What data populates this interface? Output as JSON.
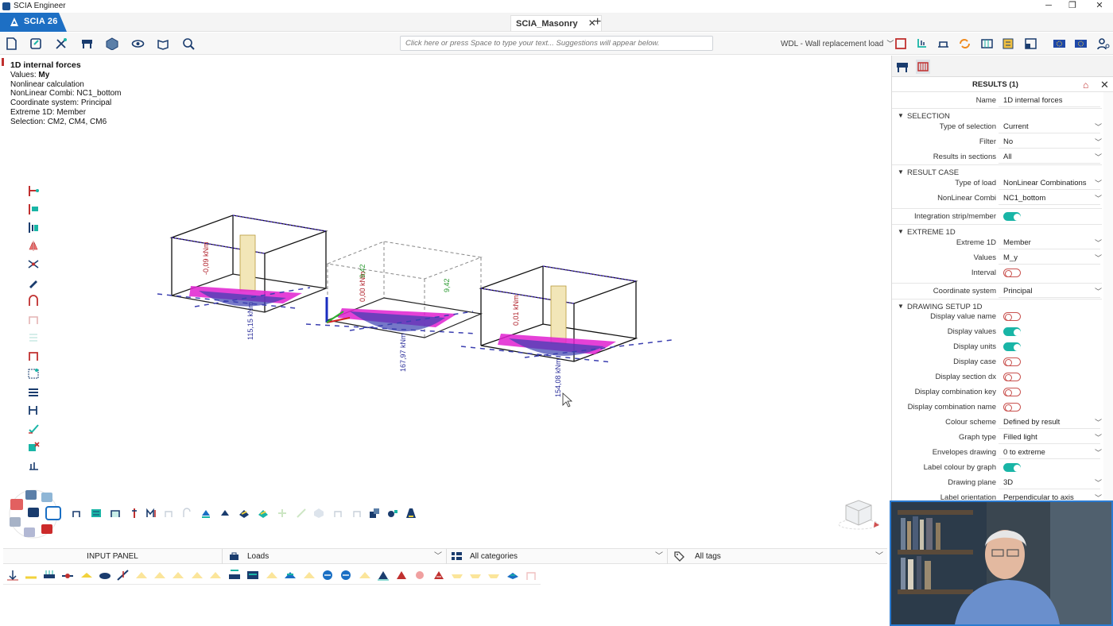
{
  "window": {
    "title": "SCIA Engineer",
    "controls": [
      "─",
      "❐",
      "✕"
    ]
  },
  "tabs": {
    "brand": "SCIA 26",
    "document": "SCIA_Masonry",
    "close_symbol": "✕",
    "add_symbol": "+"
  },
  "toolbar": {
    "command_placeholder": "Click here or press Space to type your text... Suggestions will appear below.",
    "load_case": "WDL - Wall replacement load"
  },
  "legend": {
    "title": "1D internal forces",
    "values_label": "Values: ",
    "values_value": "My",
    "lines": [
      "Nonlinear calculation",
      "NonLinear Combi: NC1_bottom",
      "Coordinate system: Principal",
      "Extreme 1D: Member",
      "Selection: CM2, CM4, CM6"
    ]
  },
  "diagram_labels": {
    "box1_top": "-0,09 kNm",
    "box1_bottom": "115,15 kNm",
    "box2_top": "0,00 kNm",
    "box2_side_a": "9,42",
    "box2_side_b": "9,42",
    "box2_bottom": "167,97 kNm",
    "box3_top": "0,01 kNm",
    "box3_bottom": "154,08 kNm"
  },
  "colors": {
    "brand": "#1d6fc4",
    "accent_red": "#c0302f",
    "toggle_on": "#19b5a6",
    "diagram_magenta": "#e020d0",
    "diagram_blue": "#3b3fb0"
  },
  "input_panel": {
    "title": "INPUT PANEL",
    "category_group": "Loads",
    "category_filter": "All categories",
    "tag_filter": "All tags"
  },
  "results_panel": {
    "title": "RESULTS (1)",
    "name_label": "Name",
    "name_value": "1D internal forces",
    "sections": {
      "selection": "SELECTION",
      "result_case": "RESULT CASE",
      "extreme": "EXTREME 1D",
      "drawing": "DRAWING SETUP 1D"
    },
    "rows": {
      "type_of_selection": {
        "label": "Type of selection",
        "value": "Current"
      },
      "filter": {
        "label": "Filter",
        "value": "No"
      },
      "results_in_sections": {
        "label": "Results in sections",
        "value": "All"
      },
      "type_of_load": {
        "label": "Type of load",
        "value": "NonLinear Combinations"
      },
      "nonlinear_combi": {
        "label": "NonLinear Combi",
        "value": "NC1_bottom"
      },
      "integration": {
        "label": "Integration strip/member",
        "on": true
      },
      "extreme_1d": {
        "label": "Extreme 1D",
        "value": "Member"
      },
      "values": {
        "label": "Values",
        "value": "M_y"
      },
      "interval": {
        "label": "Interval",
        "on": false
      },
      "coordinate_system": {
        "label": "Coordinate system",
        "value": "Principal"
      },
      "display_value_name": {
        "label": "Display value name",
        "on": false
      },
      "display_values": {
        "label": "Display values",
        "on": true
      },
      "display_units": {
        "label": "Display units",
        "on": true
      },
      "display_case": {
        "label": "Display case",
        "on": false
      },
      "display_section_dx": {
        "label": "Display section dx",
        "on": false
      },
      "display_combination_key": {
        "label": "Display combination key",
        "on": false
      },
      "display_combination_name": {
        "label": "Display combination name",
        "on": false
      },
      "colour_scheme": {
        "label": "Colour scheme",
        "value": "Defined by result"
      },
      "graph_type": {
        "label": "Graph type",
        "value": "Filled light"
      },
      "envelopes_drawing": {
        "label": "Envelopes drawing",
        "value": "0 to extreme"
      },
      "label_colour": {
        "label": "Label colour by graph",
        "on": true
      },
      "drawing_plane": {
        "label": "Drawing plane",
        "value": "3D"
      },
      "label_orientation": {
        "label": "Label orientation",
        "value": "Perpendicular to axis"
      }
    }
  }
}
